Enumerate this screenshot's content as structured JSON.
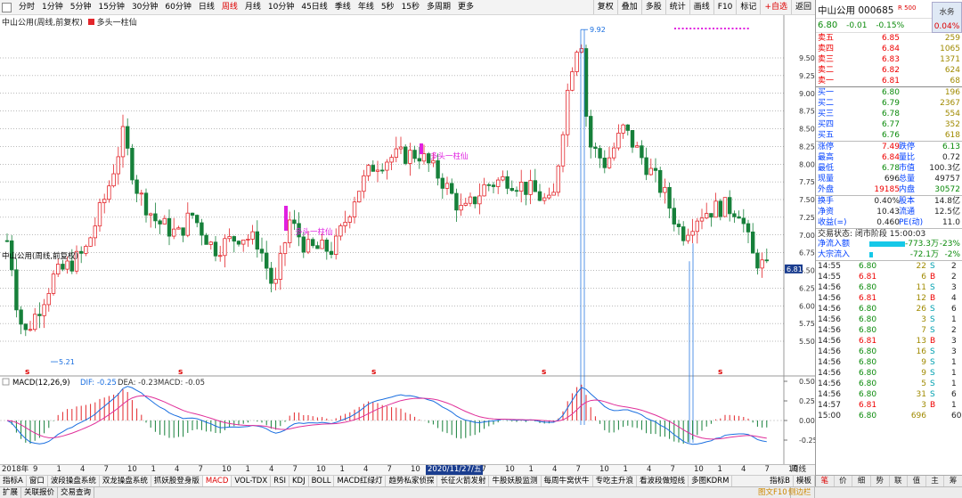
{
  "toolbar": {
    "periods": [
      "分时",
      "1分钟",
      "5分钟",
      "15分钟",
      "30分钟",
      "60分钟",
      "日线",
      "周线",
      "月线",
      "10分钟",
      "45日线",
      "季线",
      "年线",
      "5秒",
      "15秒",
      "多周期",
      "更多"
    ],
    "active_period": "周线",
    "buttons": [
      "复权",
      "叠加",
      "多股",
      "统计",
      "画线",
      "F10",
      "标记",
      "+自选",
      "返回"
    ]
  },
  "chart": {
    "title": "中山公用(周线,前复权)",
    "indicator_name": "多头一柱仙",
    "annotations": [
      "多头一柱仙",
      "多头一柱仙"
    ],
    "high_label": "9.92",
    "low_label": "5.21",
    "last_price_label": "6.81",
    "y_ticks": [
      "9.50",
      "9.25",
      "9.00",
      "8.75",
      "8.50",
      "8.25",
      "8.00",
      "7.75",
      "7.50",
      "7.25",
      "7.00",
      "6.75",
      "6.50",
      "6.25",
      "6.00",
      "5.75",
      "5.50"
    ],
    "marker_letter": "s",
    "macd": {
      "label": "MACD(12,26,9)",
      "dif_label": "DIF: -0.25",
      "dea_label": "DEA: -0.23",
      "macd_label": "MACD: -0.05",
      "y_ticks": [
        "0.50",
        "0.25",
        "0.00",
        "-0.25"
      ]
    }
  },
  "date_axis": {
    "year_label": "2018年",
    "months": [
      "9",
      "1",
      "4",
      "7",
      "10",
      "1",
      "4",
      "7",
      "10",
      "1",
      "4",
      "7",
      "10",
      "1",
      "4",
      "7",
      "10",
      "1",
      "4",
      "7",
      "10",
      "1",
      "4",
      "7",
      "10",
      "1",
      "4",
      "7",
      "10",
      "1",
      "4",
      "7",
      "10"
    ],
    "highlight_date": "2020/11/27/五",
    "right_label": "周线"
  },
  "indicator_tabs": [
    "指标A",
    "窗口",
    "波段操盘系统",
    "双龙操盘系统",
    "抓妖股登身版",
    "MACD",
    "VOL-TDX",
    "RSI",
    "KDJ",
    "BOLL",
    "MACD红绿灯",
    "趋势私家侦探",
    "长征火箭发射",
    "牛股妖股监测",
    "每周牛窝伏牛",
    "专吃主升浪",
    "看波段做短线",
    "多图KDRM",
    "指标B",
    "模板"
  ],
  "active_indicator": "MACD",
  "bottom_bar": [
    "扩展",
    "关联报价",
    "交易查询"
  ],
  "bottom_right": [
    "图文F10",
    "侧边栏"
  ],
  "quote": {
    "name": "中山公用",
    "code": "000685",
    "tag": "R 500",
    "water_label": "水务",
    "water_pct": "0.04%",
    "price": "6.80",
    "change": "-0.01",
    "change_pct": "-0.15%",
    "asks": [
      {
        "label": "卖五",
        "price": "6.85",
        "vol": "259"
      },
      {
        "label": "卖四",
        "price": "6.84",
        "vol": "1065"
      },
      {
        "label": "卖三",
        "price": "6.83",
        "vol": "1371"
      },
      {
        "label": "卖二",
        "price": "6.82",
        "vol": "624"
      },
      {
        "label": "卖一",
        "price": "6.81",
        "vol": "68"
      }
    ],
    "bids": [
      {
        "label": "买一",
        "price": "6.80",
        "vol": "196"
      },
      {
        "label": "买二",
        "price": "6.79",
        "vol": "2367"
      },
      {
        "label": "买三",
        "price": "6.78",
        "vol": "554"
      },
      {
        "label": "买四",
        "price": "6.77",
        "vol": "352"
      },
      {
        "label": "买五",
        "price": "6.76",
        "vol": "618"
      }
    ],
    "stats": [
      {
        "l1": "涨停",
        "v1": "7.49",
        "l2": "跌停",
        "v2": "6.13"
      },
      {
        "l1": "最高",
        "v1": "6.84",
        "l2": "量比",
        "v2": "0.72"
      },
      {
        "l1": "最低",
        "v1": "6.78",
        "l2": "市值",
        "v2": "100.3亿"
      },
      {
        "l1": "现量",
        "v1": "696",
        "l2": "总量",
        "v2": "49757"
      },
      {
        "l1": "外盘",
        "v1": "19185",
        "l2": "内盘",
        "v2": "30572"
      }
    ],
    "stats2": [
      {
        "l1": "换手",
        "v1": "0.40%",
        "l2": "股本",
        "v2": "14.8亿"
      },
      {
        "l1": "净资",
        "v1": "10.43",
        "l2": "流通",
        "v2": "12.5亿"
      },
      {
        "l1": "收益(=)",
        "v1": "0.460",
        "l2": "PE(动)",
        "v2": "11.0"
      }
    ],
    "status": "交易状态: 闭市阶段 15:00:03",
    "flows": [
      {
        "label": "净流入额",
        "value": "-773.3万",
        "pct": "-23%"
      },
      {
        "label": "大宗流入",
        "value": "-72.1万",
        "pct": "-2%"
      }
    ],
    "trades": [
      {
        "time": "14:55",
        "price": "6.80",
        "vol": "22",
        "dir": "S",
        "n": "2"
      },
      {
        "time": "14:55",
        "price": "6.81",
        "vol": "6",
        "dir": "B",
        "n": "2"
      },
      {
        "time": "14:56",
        "price": "6.80",
        "vol": "11",
        "dir": "S",
        "n": "3"
      },
      {
        "time": "14:56",
        "price": "6.81",
        "vol": "12",
        "dir": "B",
        "n": "4"
      },
      {
        "time": "14:56",
        "price": "6.80",
        "vol": "26",
        "dir": "S",
        "n": "6"
      },
      {
        "time": "14:56",
        "price": "6.80",
        "vol": "3",
        "dir": "S",
        "n": "1"
      },
      {
        "time": "14:56",
        "price": "6.80",
        "vol": "7",
        "dir": "S",
        "n": "2"
      },
      {
        "time": "14:56",
        "price": "6.81",
        "vol": "13",
        "dir": "B",
        "n": "3"
      },
      {
        "time": "14:56",
        "price": "6.80",
        "vol": "16",
        "dir": "S",
        "n": "3"
      },
      {
        "time": "14:56",
        "price": "6.80",
        "vol": "9",
        "dir": "S",
        "n": "1"
      },
      {
        "time": "14:56",
        "price": "6.80",
        "vol": "9",
        "dir": "S",
        "n": "1"
      },
      {
        "time": "14:56",
        "price": "6.80",
        "vol": "5",
        "dir": "S",
        "n": "1"
      },
      {
        "time": "14:56",
        "price": "6.80",
        "vol": "31",
        "dir": "S",
        "n": "6"
      },
      {
        "time": "14:57",
        "price": "6.81",
        "vol": "3",
        "dir": "B",
        "n": "1"
      },
      {
        "time": "15:00",
        "price": "6.80",
        "vol": "696",
        "dir": "",
        "n": "60"
      }
    ],
    "tabs": [
      "笔",
      "价",
      "细",
      "势",
      "联",
      "值",
      "主",
      "筹"
    ]
  },
  "colors": {
    "up": "#e3262b",
    "down": "#16803a",
    "dif": "#1a6fe0",
    "dea": "#e0309a",
    "bg": "#ffffff",
    "grid": "#555555"
  }
}
